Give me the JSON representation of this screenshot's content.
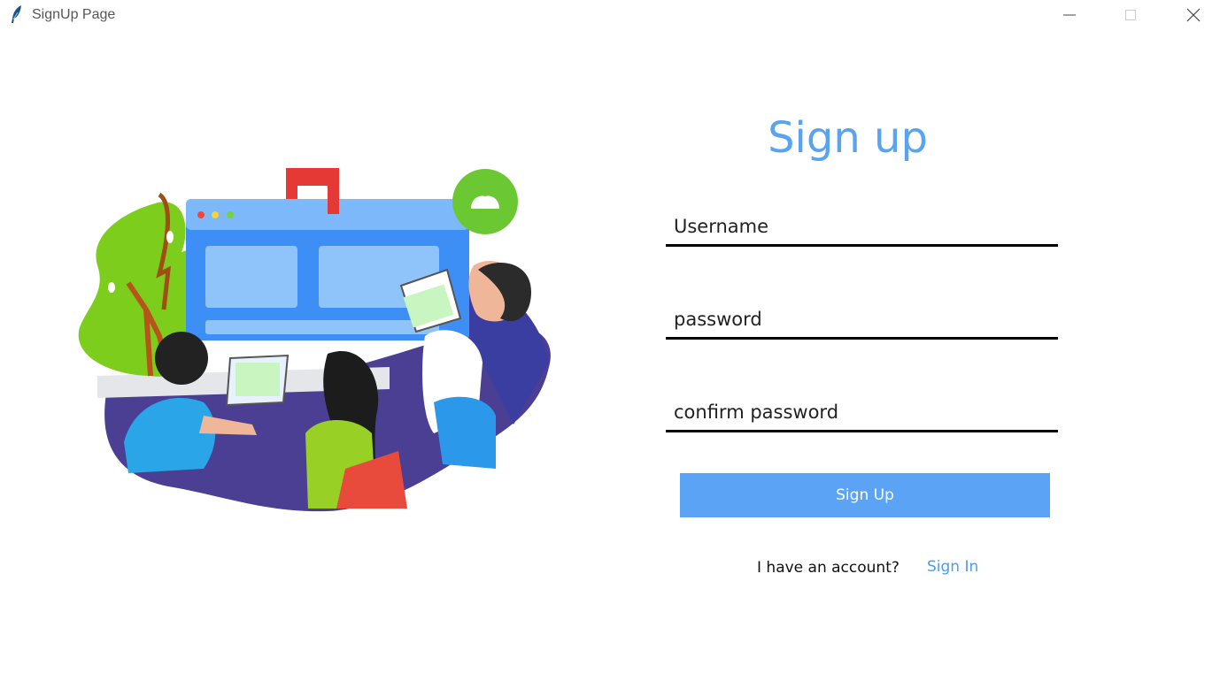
{
  "window": {
    "title": "SignUp Page",
    "icon": "feather-icon"
  },
  "form": {
    "heading": "Sign up",
    "username_value": "Username",
    "password_value": "password",
    "confirm_password_value": "confirm password",
    "submit_label": "Sign Up",
    "account_prompt": "I have an account?",
    "signin_link": "Sign In"
  },
  "colors": {
    "accent": "#5aa3f5",
    "heading": "#5aa3f0",
    "link": "#4a9cf0",
    "underline": "#000000"
  }
}
